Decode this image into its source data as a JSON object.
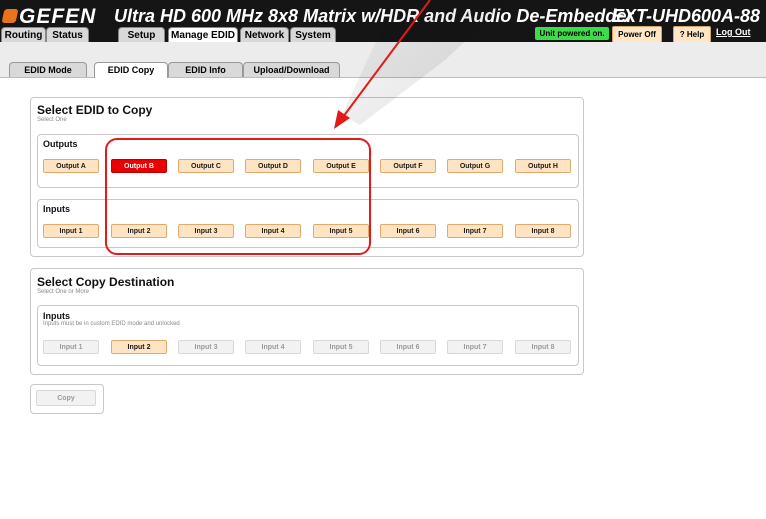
{
  "header": {
    "logo": "GEFEN",
    "title": "Ultra HD 600 MHz 8x8 Matrix w/HDR and Audio De-Embedder",
    "model": "EXT-UHD600A-88",
    "status": "Unit powered on.",
    "power_off": "Power Off",
    "help": "? Help",
    "logout": "Log Out"
  },
  "main_tabs": [
    {
      "label": "Routing"
    },
    {
      "label": "Status"
    },
    {
      "label": "Setup"
    },
    {
      "label": "Manage EDID",
      "active": true
    },
    {
      "label": "Network"
    },
    {
      "label": "System"
    }
  ],
  "sub_tabs": [
    {
      "label": "EDID Mode"
    },
    {
      "label": "EDID Copy",
      "active": true
    },
    {
      "label": "EDID Info"
    },
    {
      "label": "Upload/Download"
    }
  ],
  "select_edid": {
    "title": "Select EDID to Copy",
    "subtitle": "Select One",
    "outputs_title": "Outputs",
    "outputs": [
      "Output A",
      "Output B",
      "Output C",
      "Output D",
      "Output E",
      "Output F",
      "Output G",
      "Output H"
    ],
    "selected_output": "Output B",
    "inputs_title": "Inputs",
    "inputs": [
      "Input 1",
      "Input 2",
      "Input 3",
      "Input 4",
      "Input 5",
      "Input 6",
      "Input 7",
      "Input 8"
    ]
  },
  "copy_destination": {
    "title": "Select Copy Destination",
    "subtitle": "Select One or More",
    "inputs_title": "Inputs",
    "inputs_note": "Inputs must be in custom EDID mode and unlocked",
    "inputs": [
      "Input 1",
      "Input 2",
      "Input 3",
      "Input 4",
      "Input 5",
      "Input 6",
      "Input 7",
      "Input 8"
    ],
    "enabled_input": "Input 2"
  },
  "copy_button": "Copy",
  "colors": {
    "accent_red": "#e90000",
    "button_orange": "#ffe4c3",
    "status_green": "#3fdc4a",
    "annotation_red": "#e21a1a"
  }
}
